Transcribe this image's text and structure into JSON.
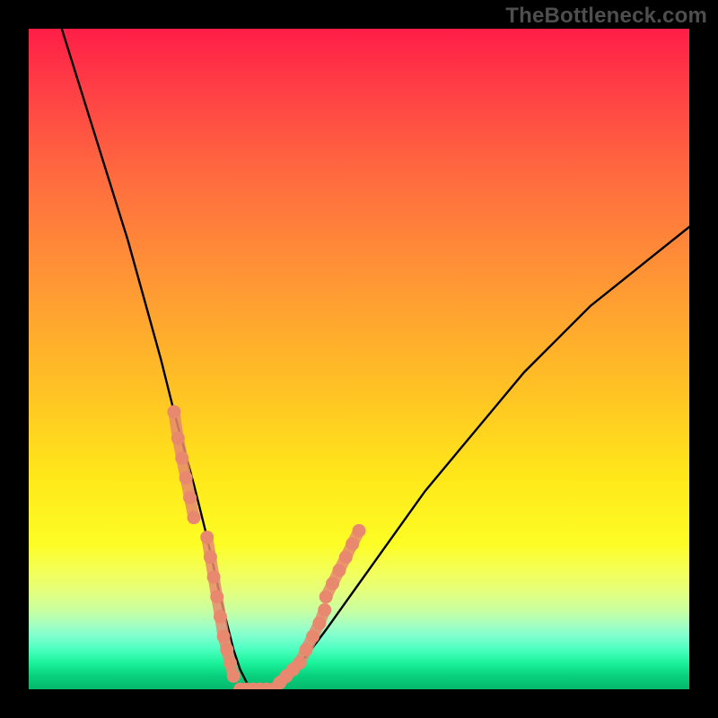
{
  "watermark": "TheBottleneck.com",
  "chart_data": {
    "type": "line",
    "title": "",
    "xlabel": "",
    "ylabel": "",
    "xlim": [
      0,
      100
    ],
    "ylim": [
      0,
      100
    ],
    "grid": false,
    "legend": false,
    "series": [
      {
        "name": "bottleneck-curve",
        "color": "#000000",
        "x": [
          5,
          10,
          15,
          20,
          22,
          25,
          27,
          29,
          30,
          31,
          32,
          33,
          34,
          35,
          36,
          38,
          40,
          42,
          45,
          50,
          55,
          60,
          65,
          70,
          75,
          80,
          85,
          90,
          95,
          100
        ],
        "y": [
          100,
          84,
          68,
          50,
          42,
          31,
          23,
          14,
          10,
          6,
          3,
          1,
          0,
          0,
          0,
          1,
          3,
          5,
          9,
          16,
          23,
          30,
          36,
          42,
          48,
          53,
          58,
          62,
          66,
          70
        ]
      },
      {
        "name": "highlight-left-upper",
        "color": "#e8896f",
        "x": [
          22.0,
          22.6,
          23.2,
          23.8,
          24.4,
          25.0
        ],
        "y": [
          42,
          38,
          35,
          32,
          29,
          26
        ]
      },
      {
        "name": "highlight-left-lower",
        "color": "#e8896f",
        "x": [
          27.0,
          27.5,
          28.0,
          28.5,
          29.0,
          29.5,
          30.0,
          30.5,
          31.0
        ],
        "y": [
          23,
          20,
          17,
          14,
          11,
          8,
          6,
          4,
          2
        ]
      },
      {
        "name": "highlight-bottom",
        "color": "#e8896f",
        "x": [
          32.0,
          33.0,
          34.0,
          35.0,
          36.0,
          37.0
        ],
        "y": [
          0,
          0,
          0,
          0,
          0,
          0
        ]
      },
      {
        "name": "highlight-right-lower",
        "color": "#e8896f",
        "x": [
          38.0,
          39.0,
          40.0,
          41.0,
          42.0,
          43.0,
          44.0,
          44.8
        ],
        "y": [
          1,
          2,
          3,
          4,
          6,
          8,
          10,
          12
        ]
      },
      {
        "name": "highlight-right-upper",
        "color": "#e8896f",
        "x": [
          45.0,
          46.0,
          47.0,
          48.0,
          49.0,
          50.0
        ],
        "y": [
          14,
          16,
          18,
          20,
          22,
          24
        ]
      }
    ],
    "background_gradient": {
      "direction": "vertical",
      "stops": [
        {
          "pos": 0.0,
          "color": "#ff1e47"
        },
        {
          "pos": 0.22,
          "color": "#ff6a3f"
        },
        {
          "pos": 0.55,
          "color": "#ffc324"
        },
        {
          "pos": 0.78,
          "color": "#fdfd25"
        },
        {
          "pos": 0.9,
          "color": "#a8ffbf"
        },
        {
          "pos": 1.0,
          "color": "#06b86b"
        }
      ]
    }
  }
}
